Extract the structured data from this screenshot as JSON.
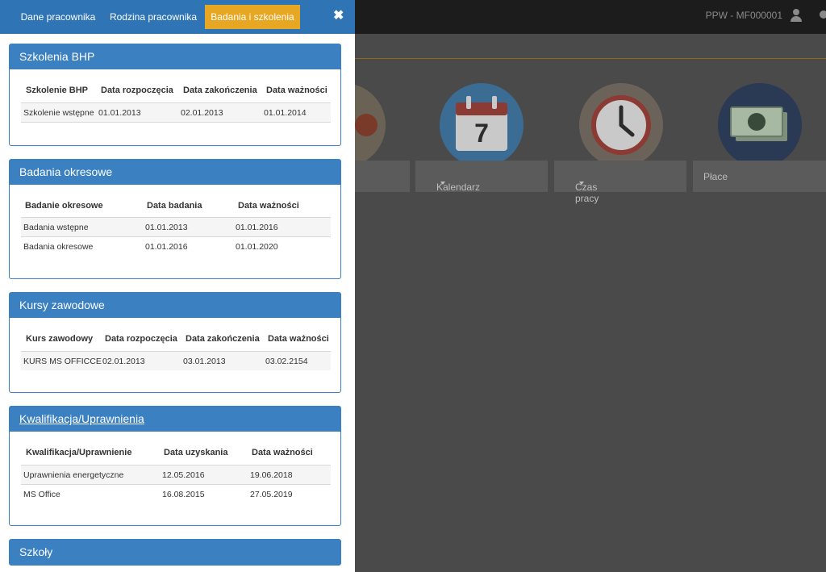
{
  "header": {
    "user_label": "PPW - MF000001",
    "user_icon": "user-icon",
    "chat_icon": "chat-icon"
  },
  "tiles": [
    {
      "label": "",
      "icon": "apple-icon"
    },
    {
      "label": "Kalendarz",
      "icon": "calendar-icon",
      "calendar_day": "7",
      "dropdown": true
    },
    {
      "label": "Czas pracy",
      "icon": "clock-icon",
      "dropdown": true
    },
    {
      "label": "Płace",
      "icon": "money-icon"
    }
  ],
  "tabs": [
    {
      "label": "Dane pracownika"
    },
    {
      "label": "Rodzina pracownika"
    },
    {
      "label": "Badania i szkolenia",
      "active": true
    }
  ],
  "close_label": "✖",
  "sections": {
    "bhp": {
      "title": "Szkolenia BHP",
      "headers": [
        "Szkolenie BHP",
        "Data rozpoczęcia",
        "Data zakończenia",
        "Data ważności"
      ],
      "rows": [
        [
          "Szkolenie wstępne",
          "01.01.2013",
          "02.01.2013",
          "01.01.2014"
        ]
      ]
    },
    "badania": {
      "title": "Badania okresowe",
      "headers": [
        "Badanie okresowe",
        "Data badania",
        "Data ważności"
      ],
      "rows": [
        [
          "Badania wstępne",
          "01.01.2013",
          "01.01.2016"
        ],
        [
          "Badania okresowe",
          "01.01.2016",
          "01.01.2020"
        ]
      ]
    },
    "kursy": {
      "title": "Kursy zawodowe",
      "headers": [
        "Kurs zawodowy",
        "Data rozpoczęcia",
        "Data zakończenia",
        "Data ważności"
      ],
      "rows": [
        [
          "KURS MS OFFICCE",
          "02.01.2013",
          "03.01.2013",
          "03.02.2154"
        ]
      ]
    },
    "kwalifikacje": {
      "title": "Kwalifikacja/Uprawnienia",
      "headers": [
        "Kwalifikacja/Uprawnienie",
        "Data uzyskania",
        "Data ważności"
      ],
      "rows": [
        [
          "Uprawnienia energetyczne",
          "12.05.2016",
          "19.06.2018"
        ],
        [
          "MS Office",
          "16.08.2015",
          "27.05.2019"
        ]
      ]
    },
    "szkoly": {
      "title": "Szkoły"
    }
  },
  "colors": {
    "tab_bar": "#2f74b4",
    "tab_active": "#e8a723",
    "card_header": "#3b80c1"
  }
}
